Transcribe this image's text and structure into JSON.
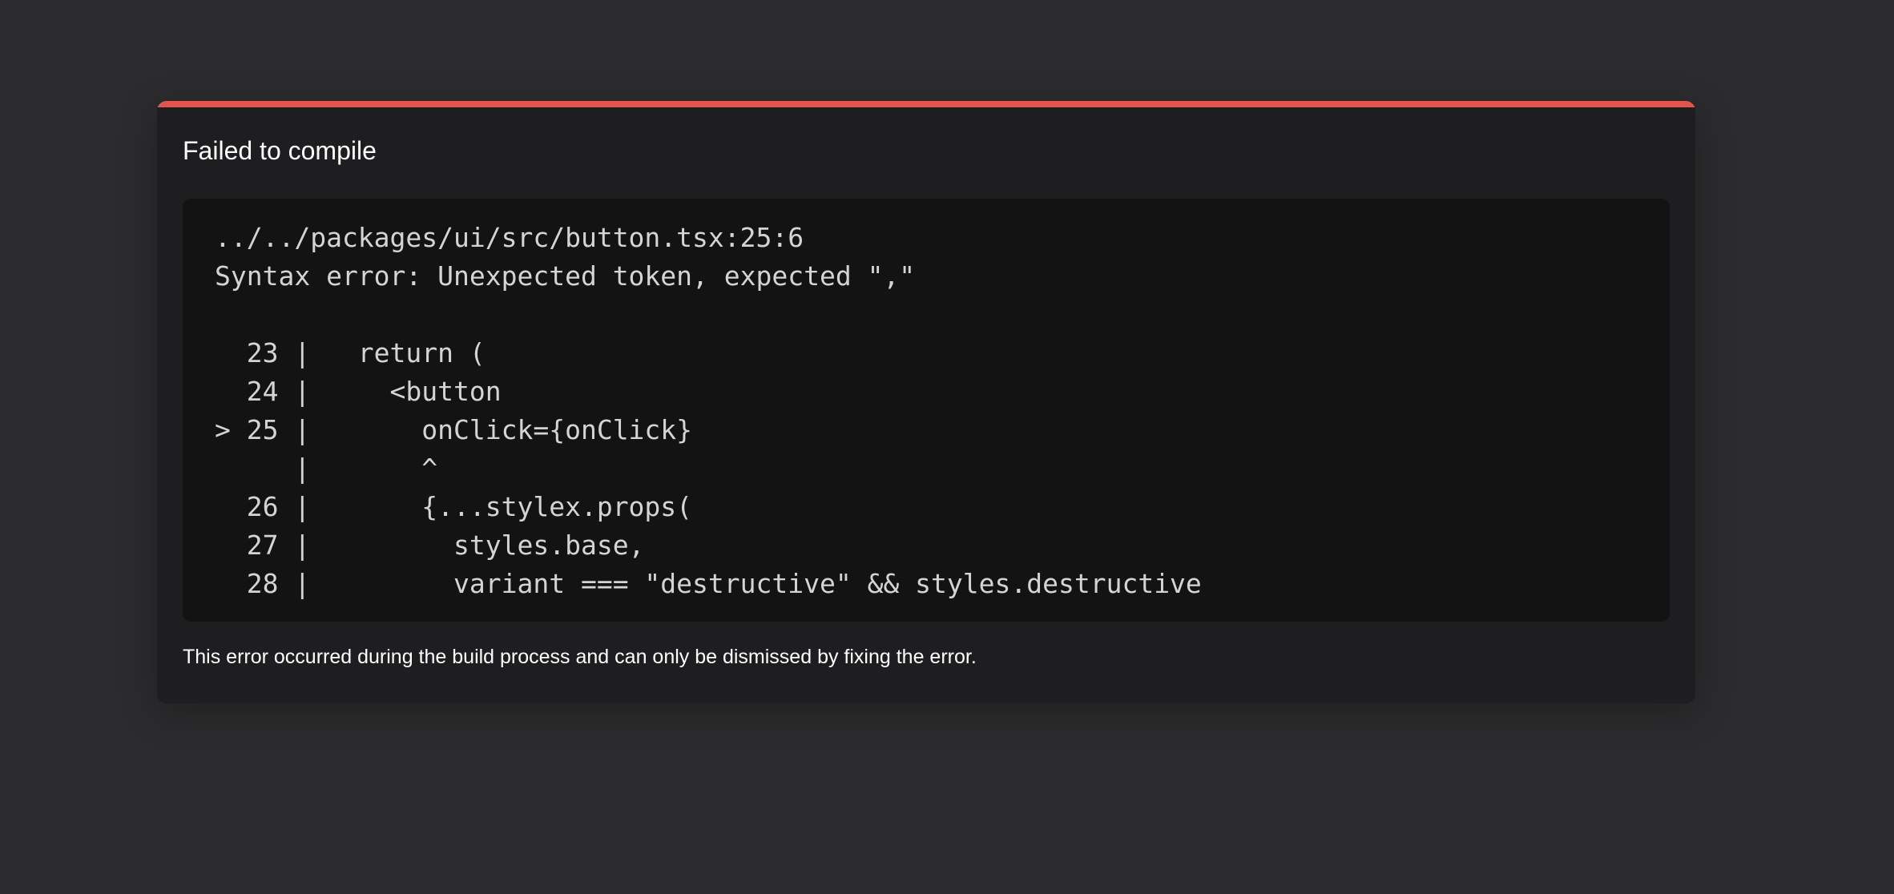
{
  "overlay": {
    "title": "Failed to compile",
    "accent_color": "#e5534b",
    "code": {
      "file_location": "../../packages/ui/src/button.tsx:25:6",
      "error_message": "Syntax error: Unexpected token, expected \",\"",
      "lines": [
        "  23 |   return (",
        "  24 |     <button",
        "> 25 |       onClick={onClick}",
        "     |       ^",
        "  26 |       {...stylex.props(",
        "  27 |         styles.base,",
        "  28 |         variant === \"destructive\" && styles.destructive"
      ]
    },
    "footer": "This error occurred during the build process and can only be dismissed by fixing the error."
  }
}
